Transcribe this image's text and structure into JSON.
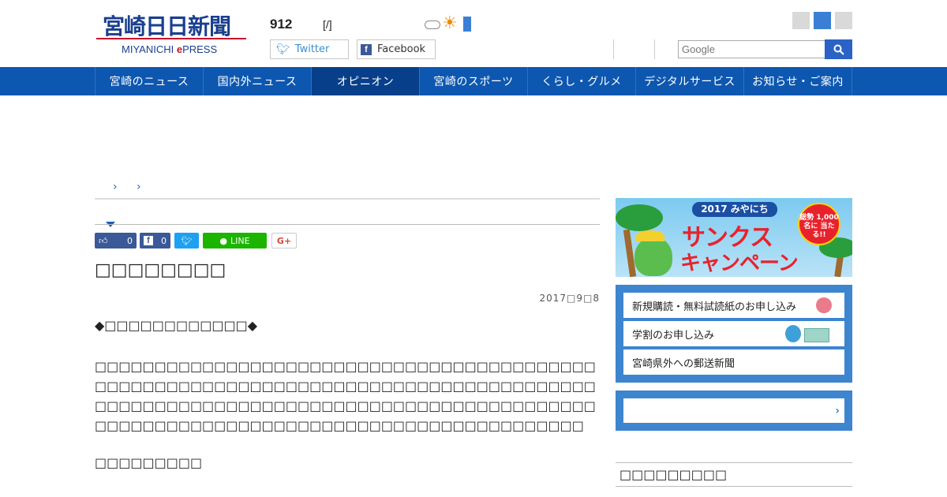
{
  "header": {
    "logo_text": "宮崎日日新聞",
    "logo_sub_pre": "MIYANICHI ",
    "logo_sub_e": "e",
    "logo_sub_post": "PRESS",
    "number": "912",
    "date": "[/]",
    "twitter_label": "Twitter",
    "facebook_label": "Facebook",
    "search_placeholder": "Google"
  },
  "nav": {
    "items": [
      "宮崎のニュース",
      "国内外ニュース",
      "オピニオン",
      "宮崎のスポーツ",
      "くらし・グルメ",
      "デジタルサービス",
      "お知らせ・ご案内"
    ],
    "active": "オピニオン"
  },
  "breadcrumb": "› ›",
  "share": {
    "like_count": "0",
    "fb_count": "0",
    "line_label": "LINE",
    "gplus_label": "G+"
  },
  "article": {
    "title": "□□□□□□□□",
    "date": "2017□9□8",
    "subhead": "◆□□□□□□□□□□□□◆",
    "body": "□□□□□□□□□□□□□□□□□□□□□□□□□□□□□□□□□□□□□□□□□□□□□□□□□□□□□□□□□□□□□□□□□□□□□□□□□□□□□□□□□□□□□□□□□□□□□□□□□□□□□□□□□□□□□□□□□□□□□□□□□□□□□□□□□□□□□□□□□□□□□□□□□□□□□□□□□□□□□□□□□□□□□□□",
    "signature": "□□□□□□□□□"
  },
  "sidebar": {
    "banner_year": "2017 みやにち",
    "banner_line1": "サンクス",
    "banner_line2": "キャンペーン",
    "banner_badge": "総勢 1,000名に 当たる!!",
    "links": [
      "新規購読・無料試読紙のお申し込み",
      "学割のお申し込み",
      "宮崎県外への郵送新聞"
    ],
    "panel2_arrow": "›",
    "section_title": "□□□□□□□□□"
  },
  "colors": {
    "nav_bg": "#0d57b0",
    "nav_active": "#083f8a",
    "accent": "#2a62c5",
    "line_green": "#1bb500"
  }
}
